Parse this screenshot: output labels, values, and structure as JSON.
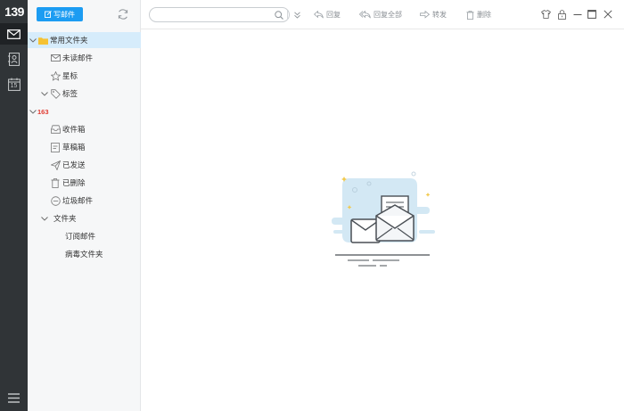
{
  "app": {
    "logo_text": "139",
    "accent_color": "#1c9cf2",
    "brand_red": "#e03a30"
  },
  "rail": {
    "items": [
      {
        "icon": "mail-icon",
        "active": true
      },
      {
        "icon": "contacts-icon",
        "active": false
      },
      {
        "icon": "calendar-icon",
        "label": "15",
        "active": false
      },
      {
        "icon": "menu-icon",
        "active": false
      }
    ]
  },
  "sidebar": {
    "compose_label": "写邮件",
    "refresh_icon": "refresh-icon",
    "common_folder": {
      "label": "常用文件夹",
      "items": [
        {
          "label": "未读邮件",
          "icon": "unread-mail-icon"
        },
        {
          "label": "星标",
          "icon": "star-icon"
        },
        {
          "label": "标签",
          "icon": "tag-icon"
        }
      ]
    },
    "account": {
      "badge": "163",
      "items": [
        {
          "label": "收件箱",
          "icon": "inbox-icon"
        },
        {
          "label": "草稿箱",
          "icon": "draft-icon"
        },
        {
          "label": "已发送",
          "icon": "sent-icon"
        },
        {
          "label": "已删除",
          "icon": "trash-icon"
        },
        {
          "label": "垃圾邮件",
          "icon": "spam-icon"
        }
      ],
      "folder_group": {
        "label": "文件夹",
        "items": [
          {
            "label": "订阅邮件"
          },
          {
            "label": "病毒文件夹"
          }
        ]
      }
    }
  },
  "toolbar": {
    "search_value": "",
    "search_placeholder": "",
    "reply_label": "回复",
    "reply_all_label": "回复全部",
    "forward_label": "转发",
    "delete_label": "删除"
  },
  "main": {
    "empty_illustration": "empty-mail-illustration"
  }
}
